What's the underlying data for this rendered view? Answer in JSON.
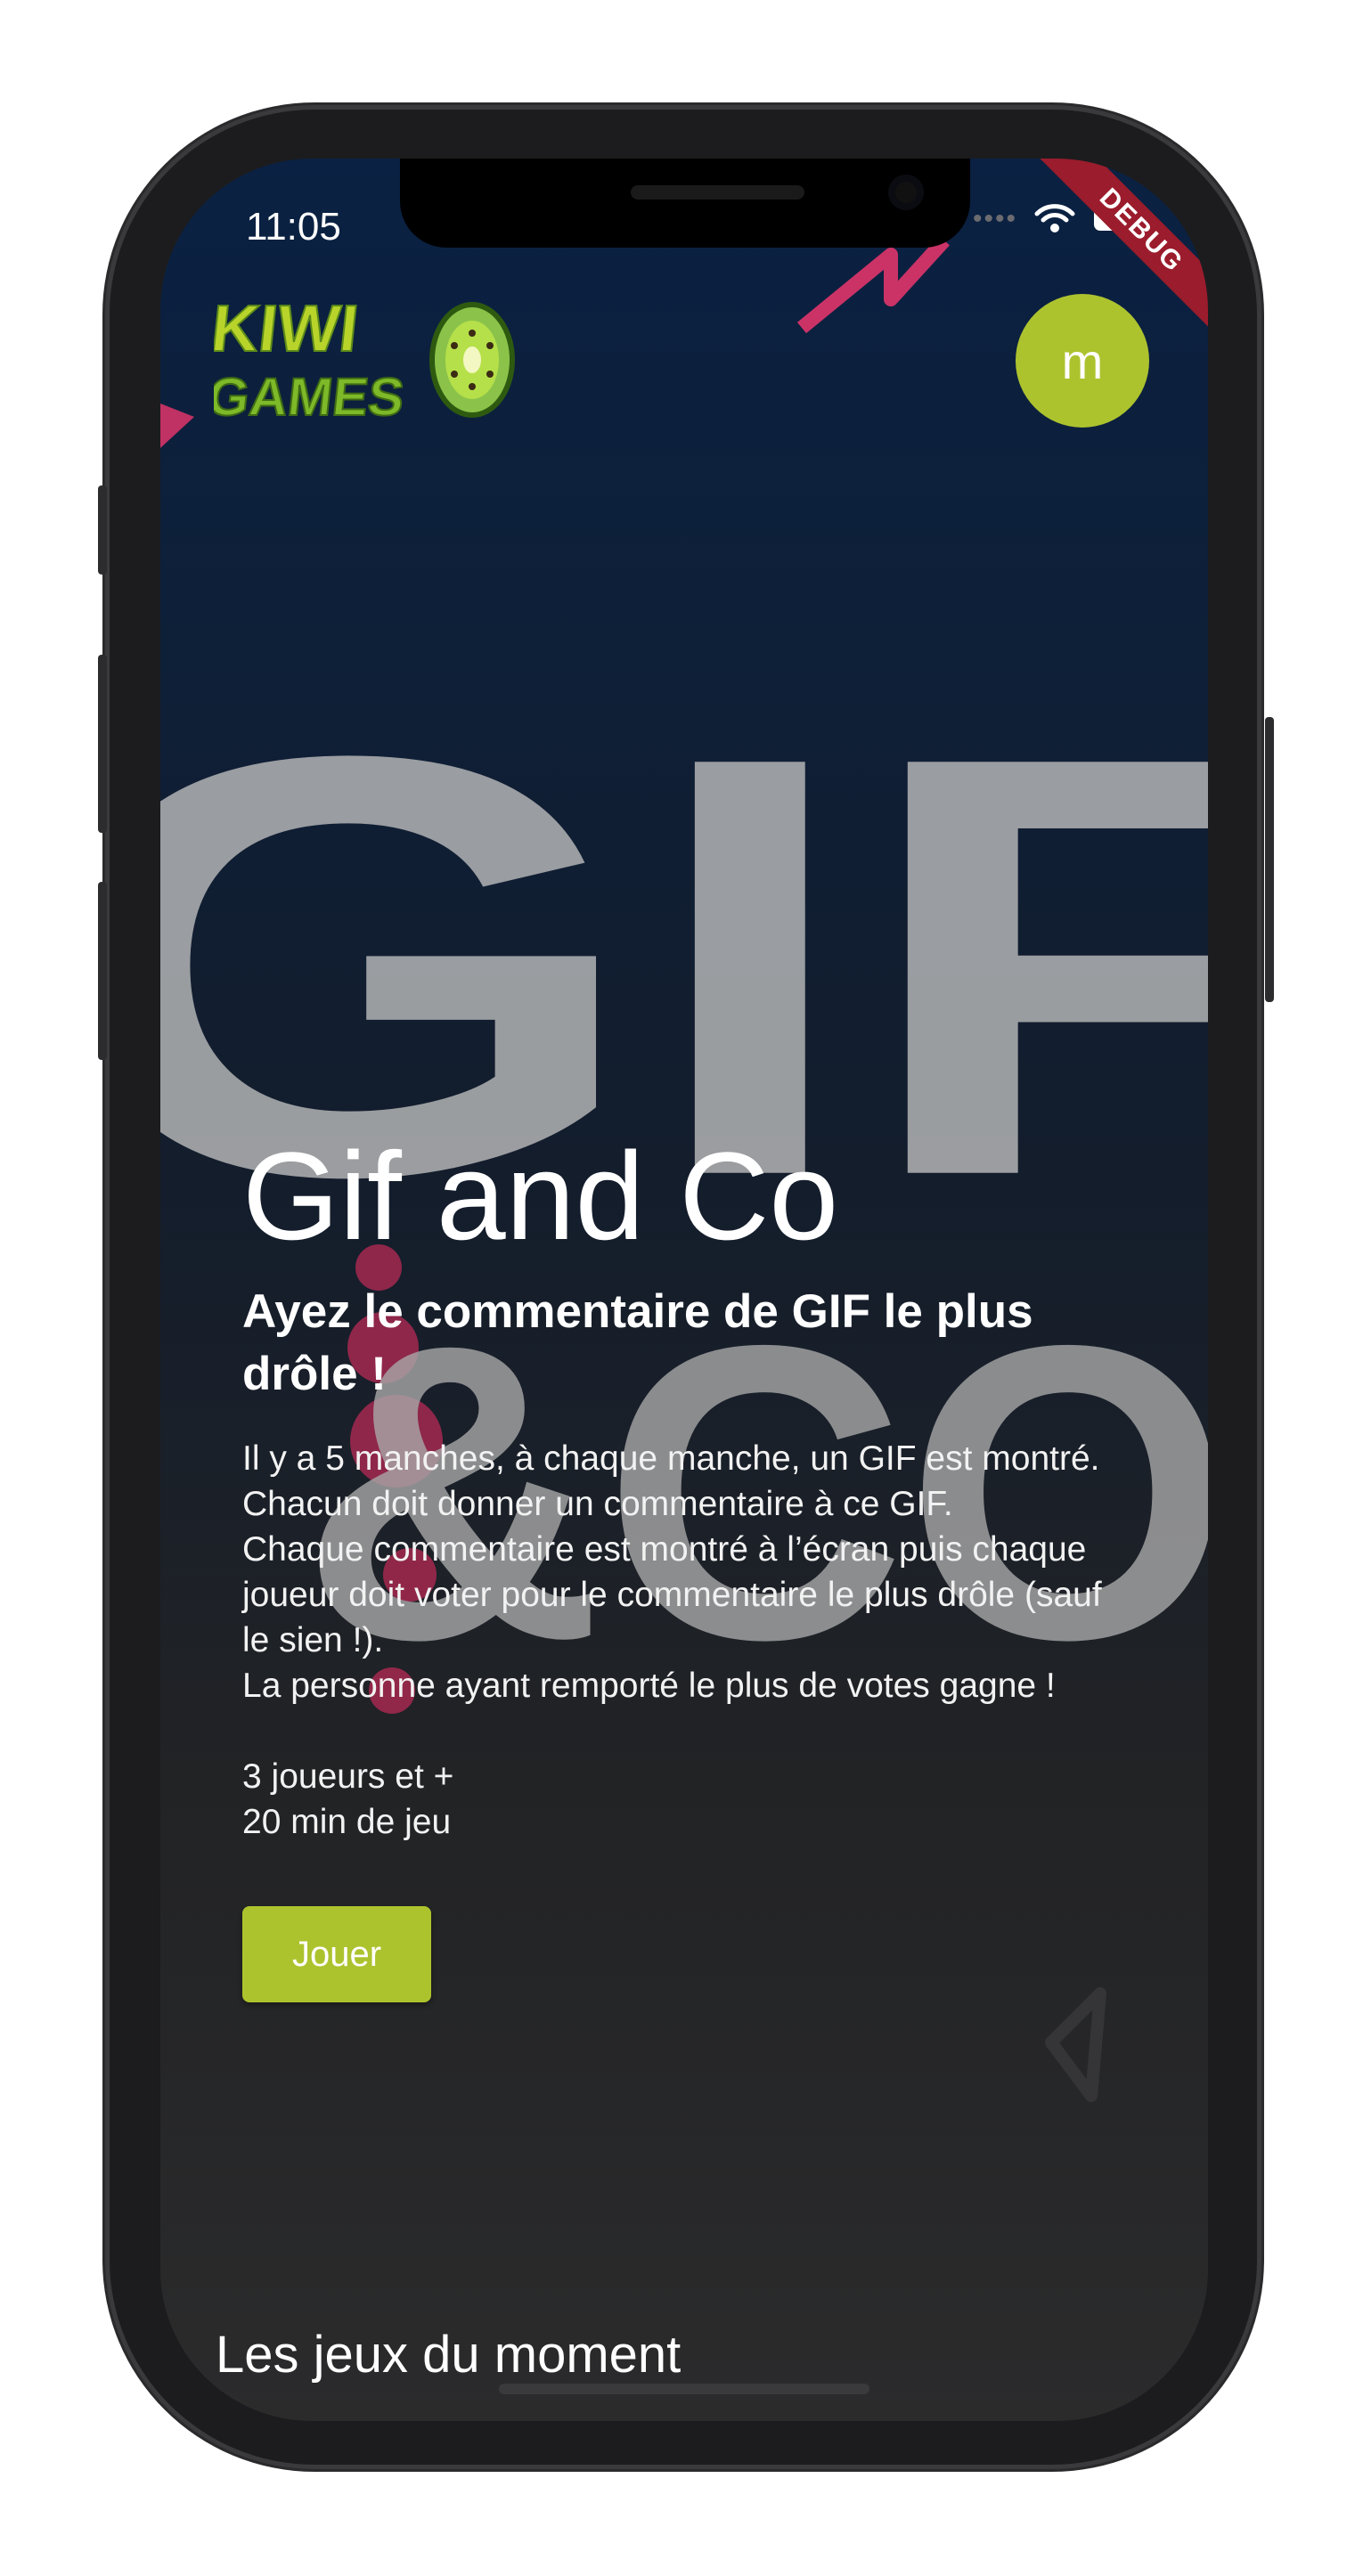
{
  "status_bar": {
    "time": "11:05",
    "debug": "DEBUG"
  },
  "header": {
    "logo_line1": "KIWI",
    "logo_line2": "GAMES",
    "avatar_initial": "m"
  },
  "game": {
    "title": "Gif and Co",
    "subtitle": "Ayez le commentaire de GIF le plus drôle !",
    "description": "Il y a 5 manches, à chaque manche, un GIF est montré. Chacun doit donner un commentaire à ce GIF.\nChaque commentaire est montré à l’écran puis chaque joueur doit voter pour le commentaire le plus drôle (sauf le sien !).\nLa personne ayant remporté le plus de votes gagne !\n\n3 joueurs et +\n20 min de jeu",
    "play_label": "Jouer",
    "background_art_text_1": "GIF",
    "background_art_text_2": "&CO"
  },
  "sections": {
    "trending_title": "Les jeux du moment"
  },
  "colors": {
    "accent": "#adc32e",
    "debug_ribbon": "#9b1c2c",
    "background_top": "#0a2143",
    "background_bottom": "#2b2b2c",
    "decor_pink": "#e0356b"
  }
}
